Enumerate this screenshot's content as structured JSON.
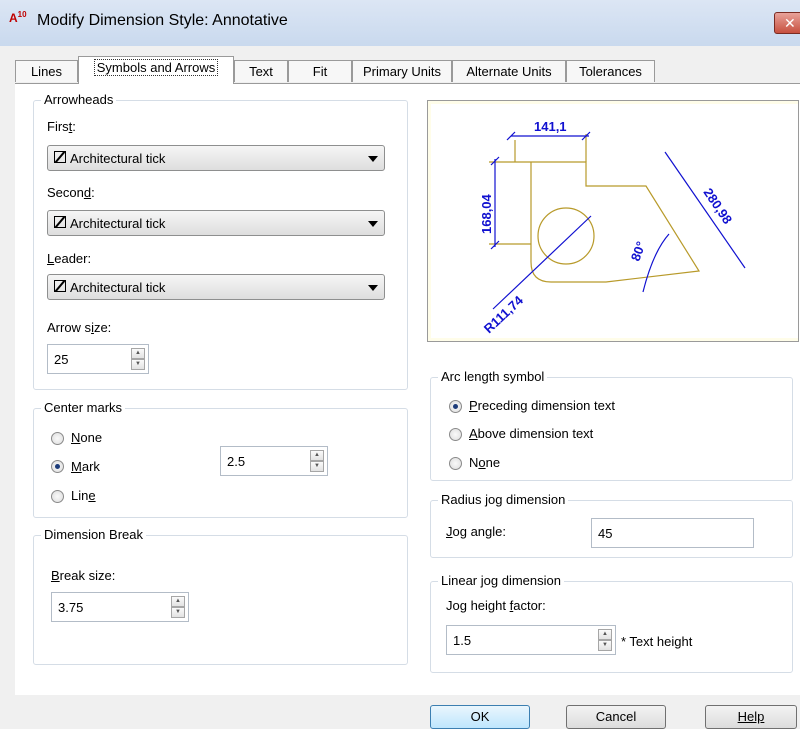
{
  "window": {
    "app_icon": "A",
    "app_icon_version": "10",
    "title": "Modify Dimension Style: Annotative",
    "close": "✕"
  },
  "tabs": [
    {
      "label": "Lines"
    },
    {
      "label": "Symbols and Arrows"
    },
    {
      "label": "Text"
    },
    {
      "label": "Fit"
    },
    {
      "label": "Primary Units"
    },
    {
      "label": "Alternate Units"
    },
    {
      "label": "Tolerances"
    }
  ],
  "arrowheads": {
    "title": "Arrowheads",
    "first_label": "First:",
    "first_value": "Architectural tick",
    "second_label": "Second:",
    "second_value": "Architectural tick",
    "leader_label": "Leader:",
    "leader_value": "Architectural tick",
    "arrow_size_label": "Arrow size:",
    "arrow_size_value": "25"
  },
  "center_marks": {
    "title": "Center marks",
    "none_label": "None",
    "mark_label": "Mark",
    "line_label": "Line",
    "selected": "Mark",
    "size_value": "2.5"
  },
  "dimension_break": {
    "title": "Dimension Break",
    "break_size_label": "Break size:",
    "break_size_value": "3.75"
  },
  "preview": {
    "dim_top": "141,1",
    "dim_left": "168,04",
    "dim_right": "280,98",
    "angle": "80°",
    "radius": "R111,74"
  },
  "arc_length": {
    "title": "Arc length symbol",
    "preceding_label": "Preceding dimension text",
    "above_label": "Above dimension text",
    "none_label": "None",
    "selected": "Preceding dimension text"
  },
  "radius_jog": {
    "title": "Radius jog dimension",
    "jog_angle_label": "Jog angle:",
    "jog_angle_value": "45"
  },
  "linear_jog": {
    "title": "Linear jog dimension",
    "jog_height_label": "Jog height factor:",
    "jog_height_value": "1.5",
    "suffix": "* Text height"
  },
  "buttons": {
    "ok": "OK",
    "cancel": "Cancel",
    "help": "Help"
  }
}
